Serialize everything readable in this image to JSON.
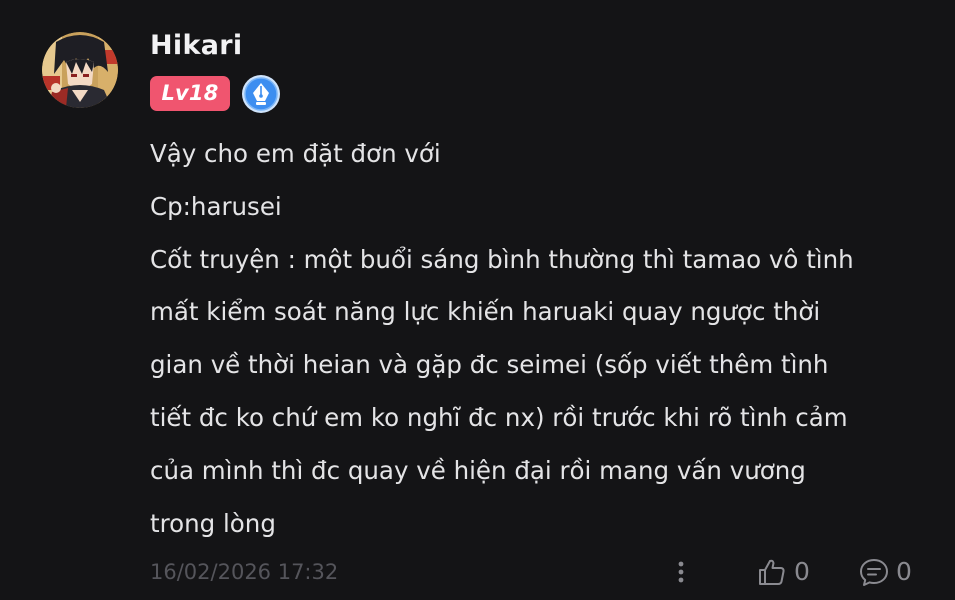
{
  "comment": {
    "username": "Hikari",
    "level_badge": "Lv18",
    "avatar_icon": "avatar-image",
    "creator_badge_icon": "pen-nib-icon",
    "body_lines": [
      "Vậy cho em đặt đơn với",
      "Cp:harusei",
      "Cốt truyện : một buổi sáng bình thường thì tamao vô tình",
      "mất kiểm soát năng lực khiến haruaki quay ngược thời",
      "gian về thời heian và gặp đc seimei (sốp viết thêm tình",
      "tiết đc ko chứ em ko nghĩ đc nx) rồi trước khi rõ tình cảm",
      "của mình thì đc quay về hiện đại rồi mang vấn vương",
      "trong lòng"
    ],
    "timestamp": "16/02/2026 17:32",
    "like_count": "0",
    "reply_count": "0"
  },
  "colors": {
    "background": "#141416",
    "level_badge": "#f0556f",
    "creator_badge": "#3d8ef0",
    "muted_text": "#55555b",
    "icon": "#8a8a90"
  }
}
